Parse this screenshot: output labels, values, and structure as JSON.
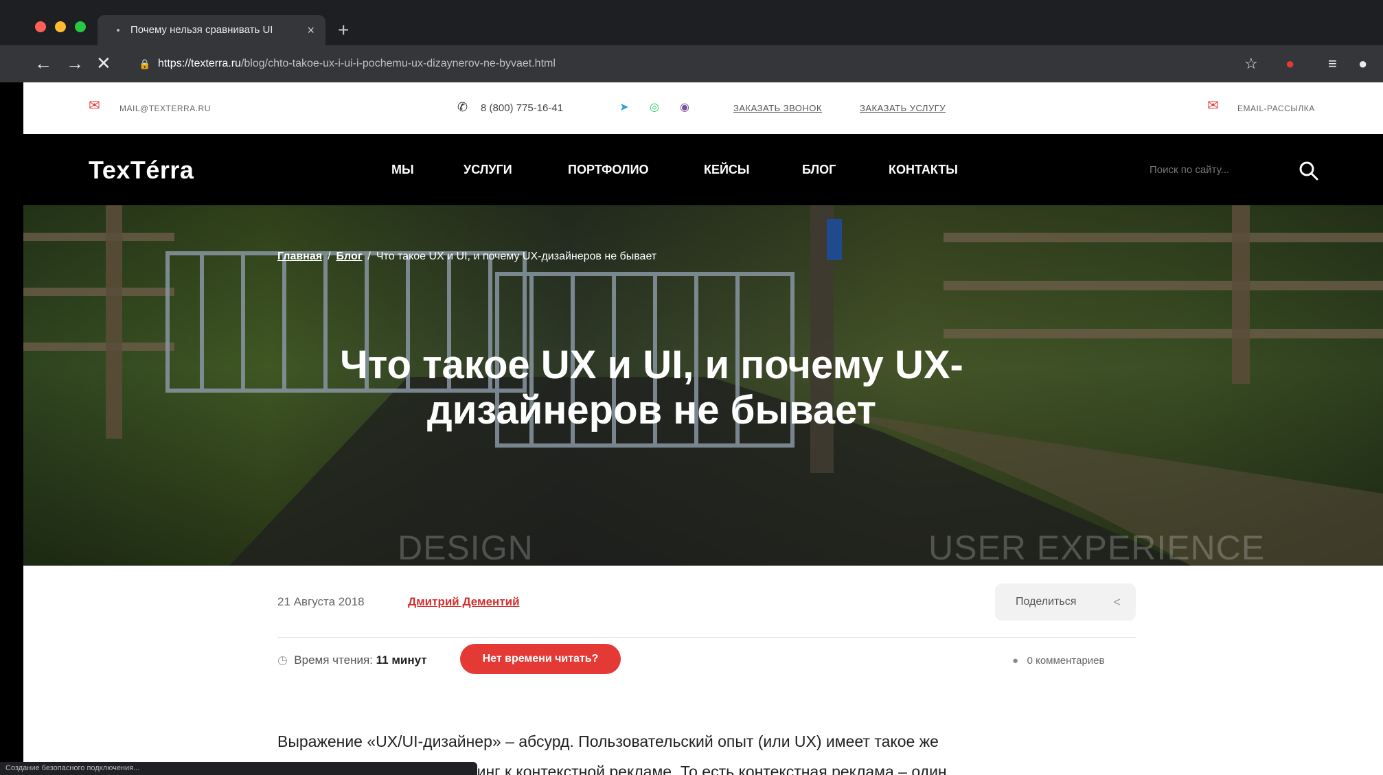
{
  "browser": {
    "tab_title": "Почему нельзя сравнивать UI",
    "tab_close": "×",
    "new_tab": "+",
    "url_host": "https://texterra.ru",
    "url_path": "/blog/chto-takoe-ux-i-ui-i-pochemu-ux-dizaynerov-ne-byvaet.html",
    "status_text": "Создание безопасного подключения..."
  },
  "topbar": {
    "email": "MAIL@TEXTERRA.RU",
    "phone": "8 (800) 775-16-41",
    "order_call": "ЗАКАЗАТЬ ЗВОНОК",
    "order_service": "ЗАКАЗАТЬ УСЛУГУ",
    "newsletter": "EMAIL-РАССЫЛКА"
  },
  "nav": {
    "logo": "TexTérra",
    "items": [
      "МЫ",
      "УСЛУГИ",
      "ПОРТФОЛИО",
      "КЕЙСЫ",
      "БЛОГ",
      "КОНТАКТЫ"
    ],
    "search_placeholder": "Поиск по сайту..."
  },
  "hero": {
    "breadcrumb": {
      "home": "Главная",
      "blog": "Блог",
      "current": "Что такое UX и UI, и почему UX-дизайнеров не бывает"
    },
    "title_line1": "Что такое UX и UI, и почему UX-",
    "title_line2": "дизайнеров не бывает",
    "word_left": "DESIGN",
    "word_right": "USER EXPERIENCE"
  },
  "article": {
    "date": "21 Августа 2018",
    "author": "Дмитрий Дементий",
    "share_label": "Поделиться",
    "read_time_label": "Время чтения:",
    "read_time_value": "11 минут",
    "no_time_button": "Нет времени читать?",
    "comments": "0 комментариев",
    "body_line1": "Выражение «UX/UI-дизайнер» – абсурд. Пользовательский опыт (или UX) имеет такое же",
    "body_line2": "отношение к UI, как маркетинг к контекстной рекламе. То есть контекстная реклама – один"
  },
  "colors": {
    "accent": "#e53935",
    "nav_bg": "#000000",
    "chrome_bg": "#202124"
  }
}
